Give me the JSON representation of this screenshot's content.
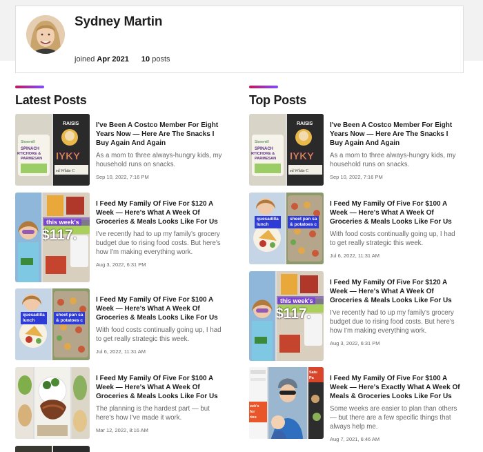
{
  "profile": {
    "name": "Sydney Martin",
    "joined_label": "joined",
    "joined_value": "Apr 2021",
    "posts_count": "10",
    "posts_label": "posts"
  },
  "latest": {
    "title": "Latest Posts",
    "posts": [
      {
        "title": "I've Been A Costco Member For Eight Years Now — Here Are The Snacks I Buy Again And Again",
        "excerpt": "As a mom to three always-hungry kids, my household runs on snacks.",
        "date": "Sep 10, 2022, 7:16 PM",
        "thumb_text": [
          "Stonemill",
          "SPINACH",
          "RTICHOKE &",
          "PARMESAN",
          "IYKY",
          "RAISIS",
          "ed White C"
        ]
      },
      {
        "title": "I Feed My Family Of Five For $120 A Week — Here's What A Week Of Groceries & Meals Looks Like For Us",
        "excerpt": "I've recently had to up my family's grocery budget due to rising food costs. But here's how I'm making everything work.",
        "date": "Aug 3, 2022, 6:31 PM",
        "thumb_text": [
          "this week's",
          "$117."
        ]
      },
      {
        "title": "I Feed My Family Of Five For $100 A Week — Here's What A Week Of Groceries & Meals Looks Like For Us",
        "excerpt": "With food costs continually going up, I had to get really strategic this week.",
        "date": "Jul 6, 2022, 11:31 AM",
        "thumb_text": [
          "quesadilla",
          "lunch",
          "sheet pan sa",
          "& potatoes c"
        ]
      },
      {
        "title": "I Feed My Family Of Five For $100 A Week — Here's What A Week Of Groceries & Meals Looks Like For Us",
        "excerpt": "The planning is the hardest part — but here's how I've made it work.",
        "date": "Mar 12, 2022, 8:16 AM",
        "thumb_text": []
      }
    ]
  },
  "top": {
    "title": "Top Posts",
    "posts": [
      {
        "title": "I've Been A Costco Member For Eight Years Now — Here Are The Snacks I Buy Again And Again",
        "excerpt": "As a mom to three always-hungry kids, my household runs on snacks.",
        "date": "Sep 10, 2022, 7:16 PM",
        "thumb_text": [
          "Stonemill",
          "SPINACH",
          "RTICHOKE &",
          "PARMESAN",
          "IYKY",
          "RAISIS",
          "ed White C"
        ]
      },
      {
        "title": "I Feed My Family Of Five For $100 A Week — Here's What A Week Of Groceries & Meals Looks Like For Us",
        "excerpt": "With food costs continually going up, I had to get really strategic this week.",
        "date": "Jul 6, 2022, 11:31 AM",
        "thumb_text": [
          "quesadilla",
          "lunch",
          "sheet pan sa",
          "& potatoes c"
        ]
      },
      {
        "title": "I Feed My Family Of Five For $120 A Week — Here's What A Week Of Groceries & Meals Looks Like For Us",
        "excerpt": "I've recently had to up my family's grocery budget due to rising food costs. But here's how I'm making everything work.",
        "date": "Aug 3, 2022, 6:31 PM",
        "thumb_text": [
          "this week's",
          "$117."
        ]
      },
      {
        "title": "I Feed My Family Of Five For $100 A Week — Here's Exactly What A Week Of Meals & Groceries Looks Like For Us",
        "excerpt": "Some weeks are easier to plan than others — but there are a few specific things that always help me.",
        "date": "Aug 7, 2021, 6:46 AM",
        "thumb_text": [
          "Satu",
          "Pa",
          "eek's",
          "for",
          "ries"
        ]
      }
    ]
  },
  "colors": {
    "accent_start": "#c2185b",
    "accent_end": "#7c4dff",
    "label_blue": "#2f3bd6"
  }
}
